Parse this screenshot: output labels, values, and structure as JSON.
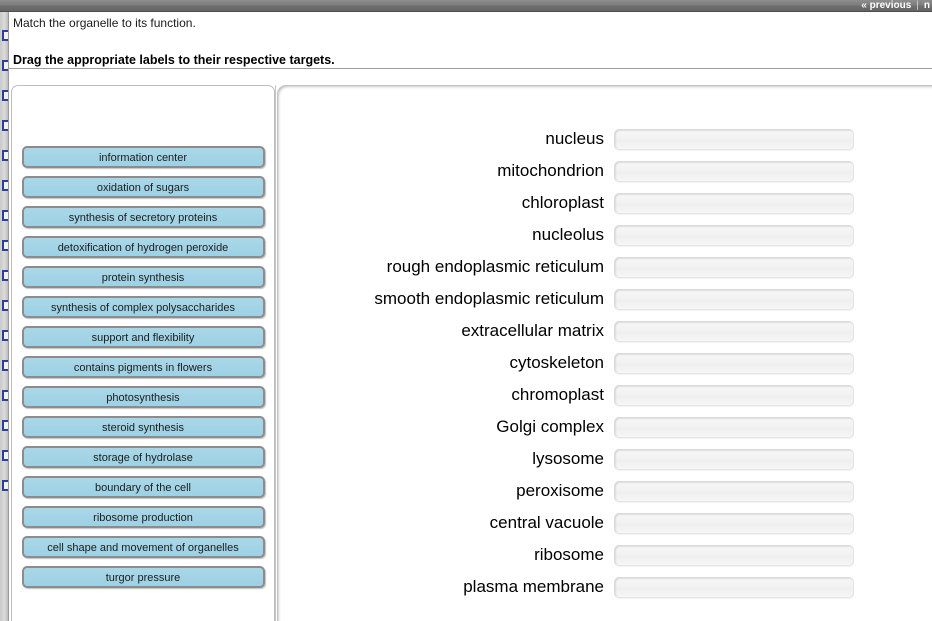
{
  "topbar": {
    "previous_label": "« previous",
    "separator": "|",
    "next_label": "n"
  },
  "header": {
    "question_text": "Match the organelle to its function.",
    "instruction_text": "Drag the appropriate labels to their respective targets."
  },
  "colors": {
    "label_fill": "#a3d4e6",
    "label_border": "#8c8c8c",
    "topbar": "#7e7e7e",
    "slot_fill": "#f2f2f2"
  },
  "label_bank": {
    "labels": [
      "information center",
      "oxidation of sugars",
      "synthesis of secretory proteins",
      "detoxification of hydrogen peroxide",
      "protein synthesis",
      "synthesis of complex polysaccharides",
      "support and flexibility",
      "contains pigments in flowers",
      "photosynthesis",
      "steroid synthesis",
      "storage of hydrolase",
      "boundary of the cell",
      "ribosome production",
      "cell shape and movement of organelles",
      "turgor pressure"
    ]
  },
  "targets": {
    "items": [
      {
        "name": "nucleus",
        "value": ""
      },
      {
        "name": "mitochondrion",
        "value": ""
      },
      {
        "name": "chloroplast",
        "value": ""
      },
      {
        "name": "nucleolus",
        "value": ""
      },
      {
        "name": "rough endoplasmic reticulum",
        "value": ""
      },
      {
        "name": "smooth endoplasmic reticulum",
        "value": ""
      },
      {
        "name": "extracellular matrix",
        "value": ""
      },
      {
        "name": "cytoskeleton",
        "value": ""
      },
      {
        "name": "chromoplast",
        "value": ""
      },
      {
        "name": "Golgi complex",
        "value": ""
      },
      {
        "name": "lysosome",
        "value": ""
      },
      {
        "name": "peroxisome",
        "value": ""
      },
      {
        "name": "central vacuole",
        "value": ""
      },
      {
        "name": "ribosome",
        "value": ""
      },
      {
        "name": "plasma membrane",
        "value": ""
      }
    ]
  }
}
